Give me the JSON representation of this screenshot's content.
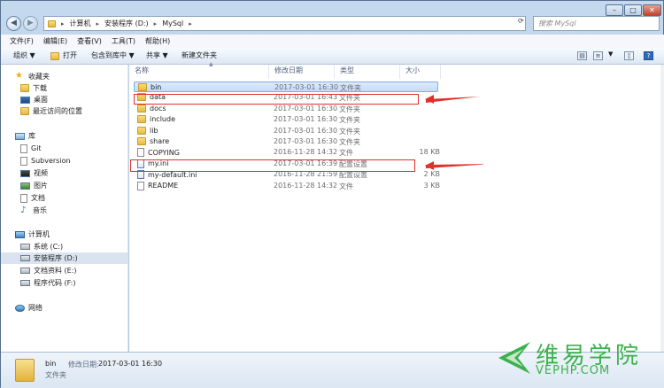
{
  "address": {
    "segments": [
      "计算机",
      "安装程序 (D:)",
      "MySql"
    ]
  },
  "search": {
    "placeholder": "搜索 MySql"
  },
  "menu": [
    "文件(F)",
    "编辑(E)",
    "查看(V)",
    "工具(T)",
    "帮助(H)"
  ],
  "toolbar": {
    "organize": "组织 ▼",
    "open": "打开",
    "include_library": "包含到库中 ▼",
    "share": "共享 ▼",
    "new_folder": "新建文件夹"
  },
  "nav": {
    "favorites": "收藏夹",
    "favorites_items": [
      "下载",
      "桌面",
      "最近访问的位置"
    ],
    "library": "库",
    "library_items": [
      "Git",
      "Subversion",
      "视频",
      "图片",
      "文档",
      "音乐"
    ],
    "computer": "计算机",
    "computer_items": [
      "系统 (C:)",
      "安装程序 (D:)",
      "文档资料 (E:)",
      "程序代码 (F:)"
    ],
    "network": "网络"
  },
  "columns": {
    "name": "名称",
    "date": "修改日期",
    "type": "类型",
    "size": "大小"
  },
  "files": [
    {
      "name": "bin",
      "date": "2017-03-01 16:30",
      "type": "文件夹",
      "size": "",
      "icon": "folder"
    },
    {
      "name": "data",
      "date": "2017-03-01 16:43",
      "type": "文件夹",
      "size": "",
      "icon": "folder"
    },
    {
      "name": "docs",
      "date": "2017-03-01 16:30",
      "type": "文件夹",
      "size": "",
      "icon": "folder"
    },
    {
      "name": "include",
      "date": "2017-03-01 16:30",
      "type": "文件夹",
      "size": "",
      "icon": "folder"
    },
    {
      "name": "lib",
      "date": "2017-03-01 16:30",
      "type": "文件夹",
      "size": "",
      "icon": "folder"
    },
    {
      "name": "share",
      "date": "2017-03-01 16:30",
      "type": "文件夹",
      "size": "",
      "icon": "folder"
    },
    {
      "name": "COPYING",
      "date": "2016-11-28 14:32",
      "type": "文件",
      "size": "18 KB",
      "icon": "file"
    },
    {
      "name": "my.ini",
      "date": "2017-03-01 16:39",
      "type": "配置设置",
      "size": "",
      "icon": "ini"
    },
    {
      "name": "my-default.ini",
      "date": "2016-11-28 21:59",
      "type": "配置设置",
      "size": "2 KB",
      "icon": "ini"
    },
    {
      "name": "README",
      "date": "2016-11-28 14:32",
      "type": "文件",
      "size": "3 KB",
      "icon": "file"
    }
  ],
  "details": {
    "name": "bin",
    "modified_label": "修改日期:",
    "modified_value": "2017-03-01 16:30",
    "type": "文件夹"
  },
  "watermark": {
    "zh": "维易学院",
    "en": "VEPHP.COM"
  },
  "colors": {
    "highlight": "#e0302a",
    "watermark": "#3db14c"
  }
}
